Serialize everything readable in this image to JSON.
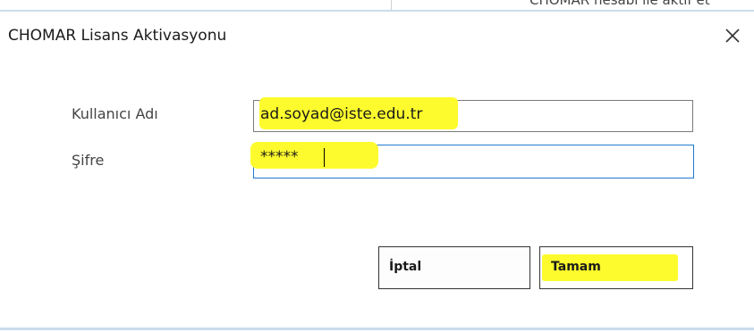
{
  "background_window": {
    "partial_text": "CHOMAR hesabı ile aktif et"
  },
  "dialog": {
    "title": "CHOMAR Lisans Aktivasyonu",
    "close_icon": "close-icon"
  },
  "form": {
    "username_label": "Kullanıcı Adı",
    "username_value": "ad.soyad@iste.edu.tr",
    "password_label": "Şifre",
    "password_value": "*****"
  },
  "buttons": {
    "cancel_label": "İptal",
    "ok_label": "Tamam"
  },
  "colors": {
    "highlight": "#fdfb2d",
    "focus_border": "#1f7ad1",
    "accent_line": "#c9dcec"
  }
}
